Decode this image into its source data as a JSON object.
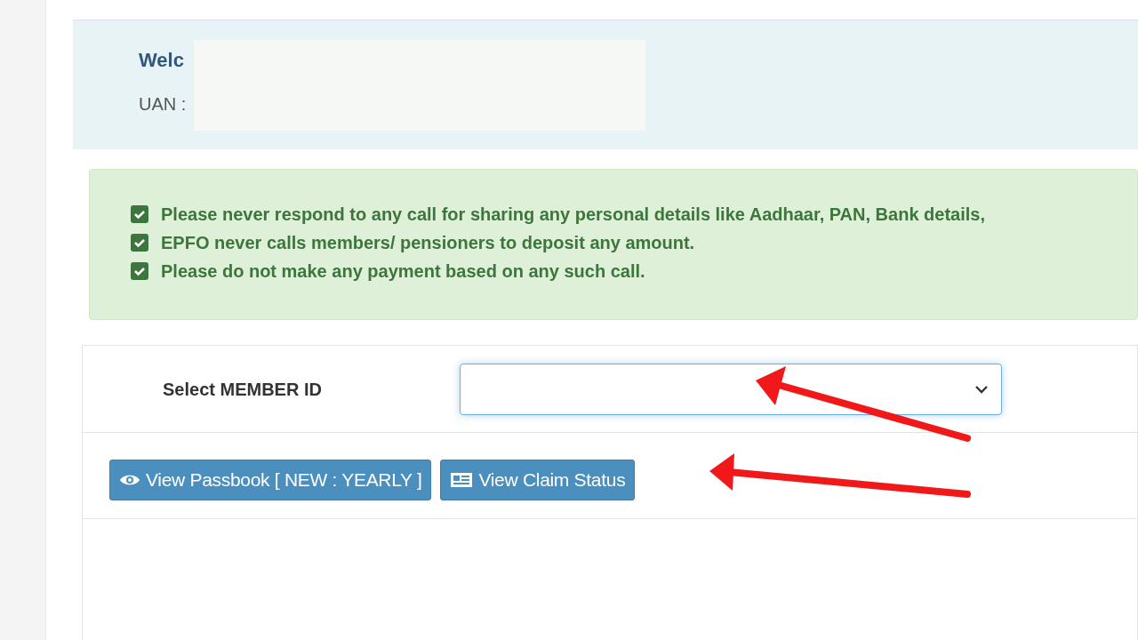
{
  "welcome": {
    "greeting": "Welc",
    "uan_label": "UAN :"
  },
  "notices": [
    {
      "text": "Please never respond to any call for sharing any personal details like Aadhaar, PAN, Bank details,",
      "checked": true
    },
    {
      "text": "EPFO never calls members/ pensioners to deposit any amount.",
      "checked": true
    },
    {
      "text": "Please do not make any payment based on any such call.",
      "checked": true
    }
  ],
  "member_select": {
    "label": "Select MEMBER ID"
  },
  "buttons": [
    {
      "label": "View Passbook [ NEW : YEARLY ]",
      "kind": "eye"
    },
    {
      "label": "View Claim Status",
      "kind": "card"
    }
  ]
}
